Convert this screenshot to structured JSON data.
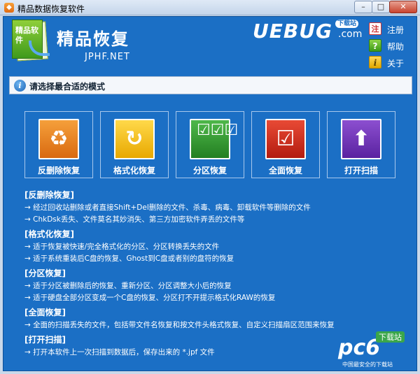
{
  "window": {
    "title": "精品数据恢复软件",
    "min": "–",
    "max": "□",
    "close": "✕"
  },
  "header": {
    "app_name": "精品恢复",
    "url": "JPHF.NET",
    "logo_text": "精品软件",
    "watermark_brand": "UEBUG",
    "watermark_tag": "下载站",
    "watermark_com": ".com"
  },
  "side_links": [
    {
      "label": "注册",
      "icon": "register-icon"
    },
    {
      "label": "帮助",
      "icon": "help-icon"
    },
    {
      "label": "关于",
      "icon": "about-icon"
    }
  ],
  "hint": {
    "text": "请选择最合适的模式",
    "icon": "i"
  },
  "modes": [
    {
      "label": "反删除恢复",
      "icon": "recycle-icon",
      "glyph": "♻"
    },
    {
      "label": "格式化恢复",
      "icon": "undo-icon",
      "glyph": "↻"
    },
    {
      "label": "分区恢复",
      "icon": "checklist-icon",
      "glyph": "☑☑☑"
    },
    {
      "label": "全面恢复",
      "icon": "checkmark-icon",
      "glyph": "☑"
    },
    {
      "label": "打开扫描",
      "icon": "arrow-up-icon",
      "glyph": "⬆"
    }
  ],
  "descriptions": [
    {
      "head": "[反删除恢复]",
      "lines": [
        "→ 经过回收站删除或者直接Shift+Del删除的文件、杀毒、病毒、卸载软件等删除的文件",
        "→ ChkDsk丢失、文件莫名其妙消失、第三方加密软件弄丢的文件等"
      ]
    },
    {
      "head": "[格式化恢复]",
      "lines": [
        "→ 适于恢复被快速/完全格式化的分区、分区转换丢失的文件",
        "→ 适于系统重装后C盘的恢复、Ghost到C盘或者别的盘符的恢复"
      ]
    },
    {
      "head": "[分区恢复]",
      "lines": [
        "→ 适于分区被删除后的恢复、重新分区、分区调整大小后的恢复",
        "→ 适于硬盘全部分区变成一个C盘的恢复、分区打不开提示格式化RAW的恢复"
      ]
    },
    {
      "head": "[全面恢复]",
      "lines": [
        "→ 全面的扫描丢失的文件，包括带文件名恢复和按文件头格式恢复、自定义扫描扇区范围来恢复"
      ]
    },
    {
      "head": "[打开扫描]",
      "lines": [
        "→ 打开本软件上一次扫描到数据后，保存出来的 *.jpf 文件"
      ]
    }
  ],
  "watermark_bottom": {
    "brand": "pc6",
    "download": "下载站",
    "sub": "中国最安全的下载站"
  },
  "colors": {
    "panel_blue": "#1b6fc5",
    "tile_border": "#a8c8ec"
  }
}
